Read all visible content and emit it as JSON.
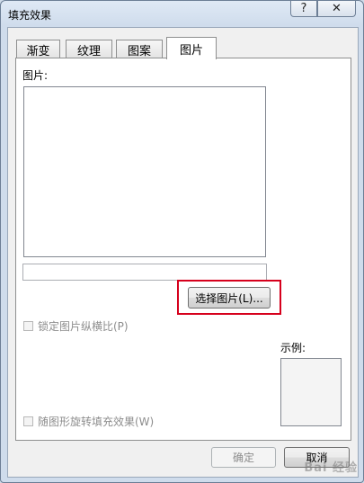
{
  "window": {
    "title": "填充效果",
    "help_glyph": "?",
    "close_glyph": "✕"
  },
  "tabs": [
    {
      "label": "渐变"
    },
    {
      "label": "纹理"
    },
    {
      "label": "图案"
    },
    {
      "label": "图片",
      "active": true
    }
  ],
  "panel": {
    "picture_label": "图片:",
    "path_value": "",
    "choose_button": "选择图片(L)...",
    "lock_aspect_label": "锁定图片纵横比(P)",
    "preview_label": "示例:",
    "rotate_label": "随图形旋转填充效果(W)"
  },
  "footer": {
    "ok_label": "确定",
    "cancel_label": "取消"
  },
  "watermark": "Bai 经验",
  "colors": {
    "highlight": "#d6001c",
    "disabled_text": "#8d8d8d"
  }
}
